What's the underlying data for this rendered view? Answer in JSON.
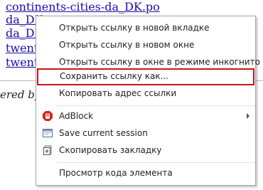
{
  "page": {
    "links": [
      "continents-cities-da_DK.po",
      "da_DK",
      "da_DK",
      "twenty",
      "twenty"
    ],
    "footer_fragment": "ered by"
  },
  "context_menu": {
    "items": [
      {
        "label": "Открыть ссылку в новой вкладке"
      },
      {
        "label": "Открыть ссылку в новом окне"
      },
      {
        "label": "Открыть ссылку в окне в режиме инкогнито"
      },
      {
        "label": "Сохранить ссылку как...",
        "highlighted": true
      },
      {
        "label": "Копировать адрес ссылки"
      },
      {
        "label": "AdBlock",
        "icon": "adblock-icon",
        "has_submenu": true
      },
      {
        "label": "Save current session",
        "icon": "session-icon"
      },
      {
        "label": "Скопировать закладку",
        "icon": "bookmark-copy-icon"
      },
      {
        "label": "Просмотр кода элемента"
      }
    ]
  },
  "colors": {
    "highlight_border": "#c4161c",
    "link": "#1a0dab",
    "adblock_red": "#d7221f"
  }
}
